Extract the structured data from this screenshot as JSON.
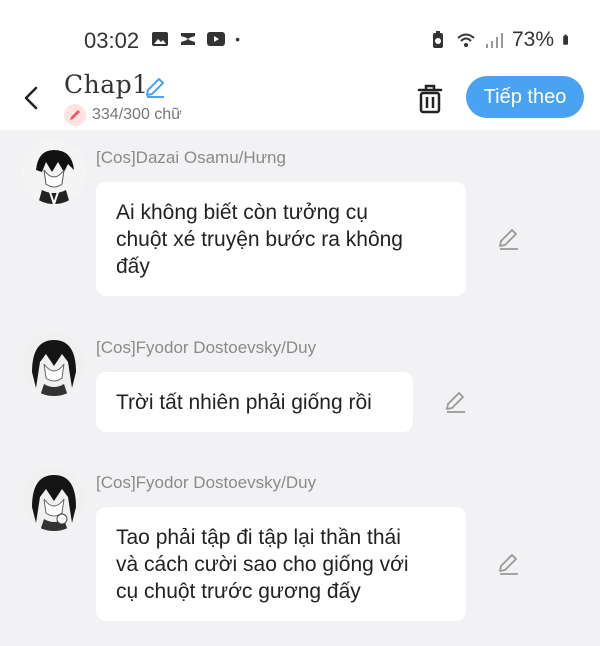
{
  "status_bar": {
    "time": "03:02",
    "battery": "73%",
    "icons": [
      "gallery-icon",
      "capcut-icon",
      "video-icon",
      "dot-icon",
      "battery-saver-icon",
      "wifi-icon",
      "signal-icon",
      "battery-icon"
    ]
  },
  "header": {
    "title": "Chap1",
    "char_count": "334/300 chữ",
    "next_label": "Tiếp theo"
  },
  "colors": {
    "accent": "#4aa3f2",
    "background": "#f2f2f4",
    "sender_text": "#8a8a8a",
    "counter_icon": "#e85c5c"
  },
  "messages": [
    {
      "sender": "[Cos]Dazai Osamu/Hưng",
      "lines": [
        "Ai không biết còn tưởng cụ",
        "chuột xé truyện bước ra không",
        "đấy"
      ]
    },
    {
      "sender": "[Cos]Fyodor Dostoevsky/Duy",
      "lines": [
        "Trời tất nhiên phải giống rồi"
      ]
    },
    {
      "sender": "[Cos]Fyodor Dostoevsky/Duy",
      "lines": [
        "Tao phải tập đi tập lại thần thái",
        "và cách cười sao cho giống với",
        "cụ chuột trước gương đấy"
      ]
    }
  ]
}
